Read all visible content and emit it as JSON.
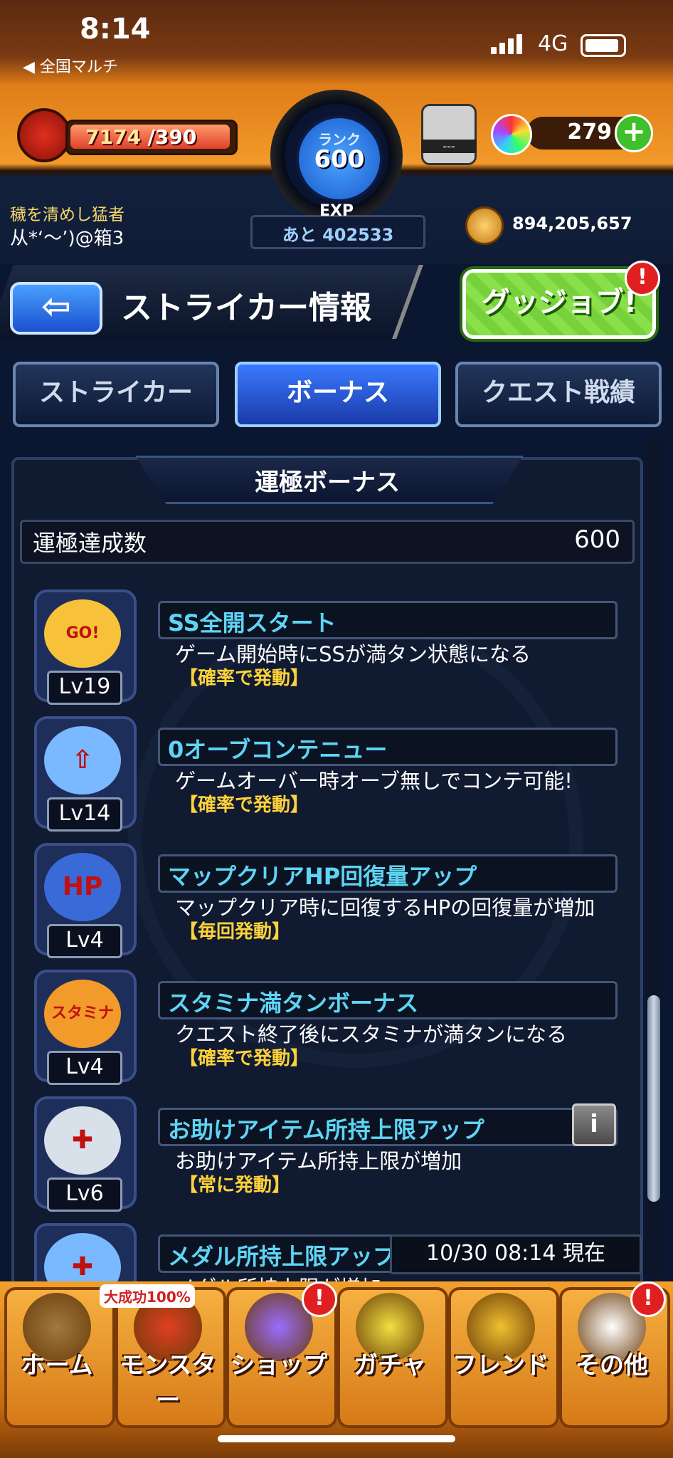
{
  "status_bar": {
    "time": "8:14",
    "back_app": "◀ 全国マルチ",
    "network": "4G"
  },
  "header": {
    "stamina_current": "7174",
    "stamina_max": " /390",
    "rank_label": "ランク",
    "rank_value": "600",
    "exp_label": "EXP",
    "exp_remaining": "あと 402533",
    "player_title": "穢を清めし猛者",
    "player_name": "从*‘〜’)@箱3",
    "orb_slot_text": "---",
    "orb_count": "279",
    "orb_add": "+",
    "coin_count": "894,205,657"
  },
  "page": {
    "back_arrow": "⇦",
    "title": "ストライカー情報",
    "goodjob_label": "グッジョブ!",
    "alert": "!"
  },
  "tabs": [
    {
      "label": "ストライカー",
      "active": false
    },
    {
      "label": "ボーナス",
      "active": true
    },
    {
      "label": "クエスト戦績",
      "active": false
    }
  ],
  "section": {
    "title": "運極ボーナス",
    "achieve_label": "運極達成数",
    "achieve_value": "600"
  },
  "bonuses": [
    {
      "icon": "go-icon",
      "icon_text": "GO!",
      "level": "Lv19",
      "name": "SS全開スタート",
      "desc": "ゲーム開始時にSSが満タン状態になる",
      "trigger": "【確率で発動】"
    },
    {
      "icon": "wings-arrow-icon",
      "icon_text": "⇧",
      "level": "Lv14",
      "name": "0オーブコンテニュー",
      "desc": "ゲームオーバー時オーブ無しでコンテ可能!",
      "trigger": "【確率で発動】"
    },
    {
      "icon": "hp-icon",
      "icon_text": "HP",
      "level": "Lv4",
      "name": "マップクリアHP回復量アップ",
      "desc": "マップクリア時に回復するHPの回復量が増加",
      "trigger": "【毎回発動】"
    },
    {
      "icon": "stamina-icon",
      "icon_text": "スタミナ",
      "level": "Lv4",
      "name": "スタミナ満タンボーナス",
      "desc": "クエスト終了後にスタミナが満タンになる",
      "trigger": "【確率で発動】"
    },
    {
      "icon": "item-plus-icon",
      "icon_text": "✚",
      "level": "Lv6",
      "name": "お助けアイテム所持上限アップ",
      "desc": "お助けアイテム所持上限が増加",
      "trigger": "【常に発動】"
    },
    {
      "icon": "medal-plus-icon",
      "icon_text": "✚",
      "level": "",
      "name": "メダル所持上限アップ",
      "desc": "メダル所持上限が増加",
      "trigger": ""
    }
  ],
  "info_button": "i",
  "timestamp": "10/30 08:14 現在",
  "promo": "大成功100%",
  "nav": [
    {
      "label": "ホーム"
    },
    {
      "label": "モンスター"
    },
    {
      "label": "ショップ"
    },
    {
      "label": "ガチャ"
    },
    {
      "label": "フレンド"
    },
    {
      "label": "その他"
    }
  ],
  "colors": {
    "accent": "#f29a2a",
    "tab_active": "#3a7aff",
    "bonus_name": "#5fd4f4",
    "trigger": "#ffd23a"
  }
}
